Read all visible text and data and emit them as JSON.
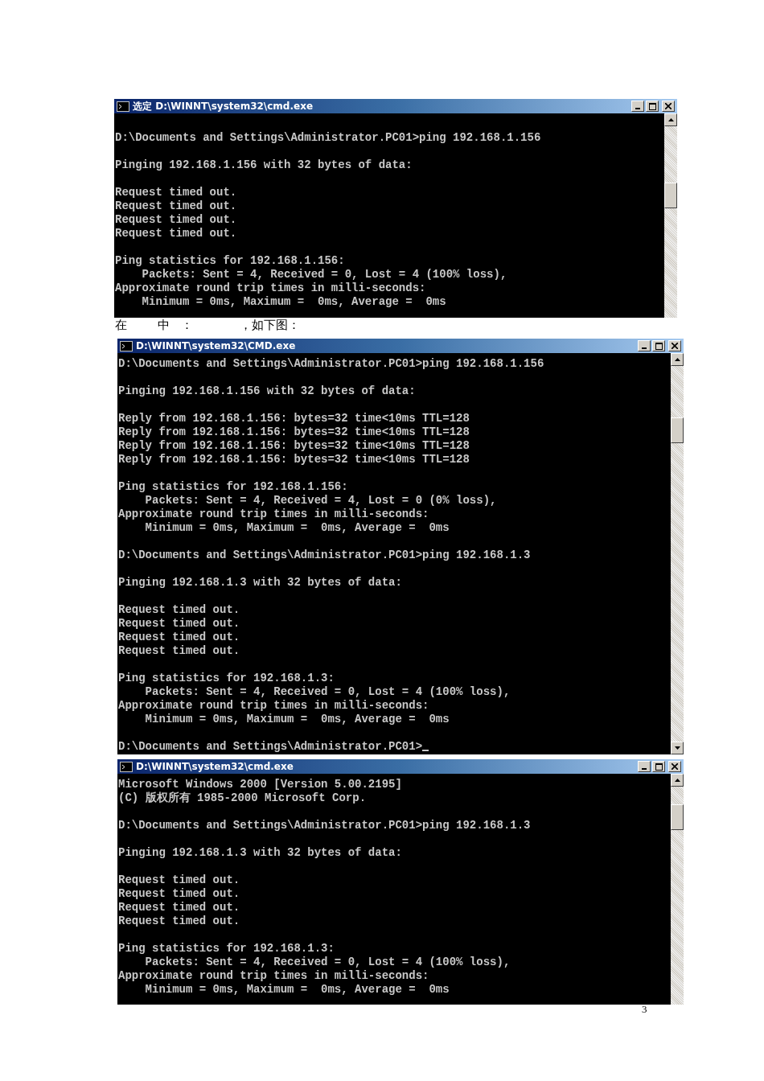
{
  "windows": [
    {
      "title": "选定 D:\\WINNT\\system32\\cmd.exe",
      "blocks": [
        [
          "D:\\Documents and Settings\\Administrator.PC01>ping 192.168.1.156"
        ],
        [
          "Pinging 192.168.1.156 with 32 bytes of data:"
        ],
        [
          "Request timed out.",
          "Request timed out.",
          "Request timed out.",
          "Request timed out."
        ],
        [
          "Ping statistics for 192.168.1.156:",
          "    Packets: Sent = 4, Received = 0, Lost = 4 (100% loss),",
          "Approximate round trip times in milli-seconds:",
          "    Minimum = 0ms, Maximum =  0ms, Average =  0ms"
        ]
      ]
    },
    {
      "caption": "在        中   ：            ，如下图："
    },
    {
      "title": "D:\\WINNT\\system32\\CMD.exe",
      "cursor": true,
      "blocks": [
        [
          "D:\\Documents and Settings\\Administrator.PC01>ping 192.168.1.156"
        ],
        [
          "Pinging 192.168.1.156 with 32 bytes of data:"
        ],
        [
          "Reply from 192.168.1.156: bytes=32 time<10ms TTL=128",
          "Reply from 192.168.1.156: bytes=32 time<10ms TTL=128",
          "Reply from 192.168.1.156: bytes=32 time<10ms TTL=128",
          "Reply from 192.168.1.156: bytes=32 time<10ms TTL=128"
        ],
        [
          "Ping statistics for 192.168.1.156:",
          "    Packets: Sent = 4, Received = 4, Lost = 0 (0% loss),",
          "Approximate round trip times in milli-seconds:",
          "    Minimum = 0ms, Maximum =  0ms, Average =  0ms"
        ],
        [
          "D:\\Documents and Settings\\Administrator.PC01>ping 192.168.1.3"
        ],
        [
          "Pinging 192.168.1.3 with 32 bytes of data:"
        ],
        [
          "Request timed out.",
          "Request timed out.",
          "Request timed out.",
          "Request timed out."
        ],
        [
          "Ping statistics for 192.168.1.3:",
          "    Packets: Sent = 4, Received = 0, Lost = 4 (100% loss),",
          "Approximate round trip times in milli-seconds:",
          "    Minimum = 0ms, Maximum =  0ms, Average =  0ms"
        ],
        [
          "D:\\Documents and Settings\\Administrator.PC01>"
        ]
      ]
    },
    {
      "title": "D:\\WINNT\\system32\\cmd.exe",
      "blocks": [
        [
          "Microsoft Windows 2000 [Version 5.00.2195]",
          "(C) 版权所有 1985-2000 Microsoft Corp."
        ],
        [
          "D:\\Documents and Settings\\Administrator.PC01>ping 192.168.1.3"
        ],
        [
          "Pinging 192.168.1.3 with 32 bytes of data:"
        ],
        [
          "Request timed out.",
          "Request timed out.",
          "Request timed out.",
          "Request timed out."
        ],
        [
          "Ping statistics for 192.168.1.3:",
          "    Packets: Sent = 4, Received = 0, Lost = 4 (100% loss),",
          "Approximate round trip times in milli-seconds:",
          "    Minimum = 0ms, Maximum =  0ms, Average =  0ms"
        ]
      ]
    },
    {
      "page_number": "3"
    }
  ]
}
